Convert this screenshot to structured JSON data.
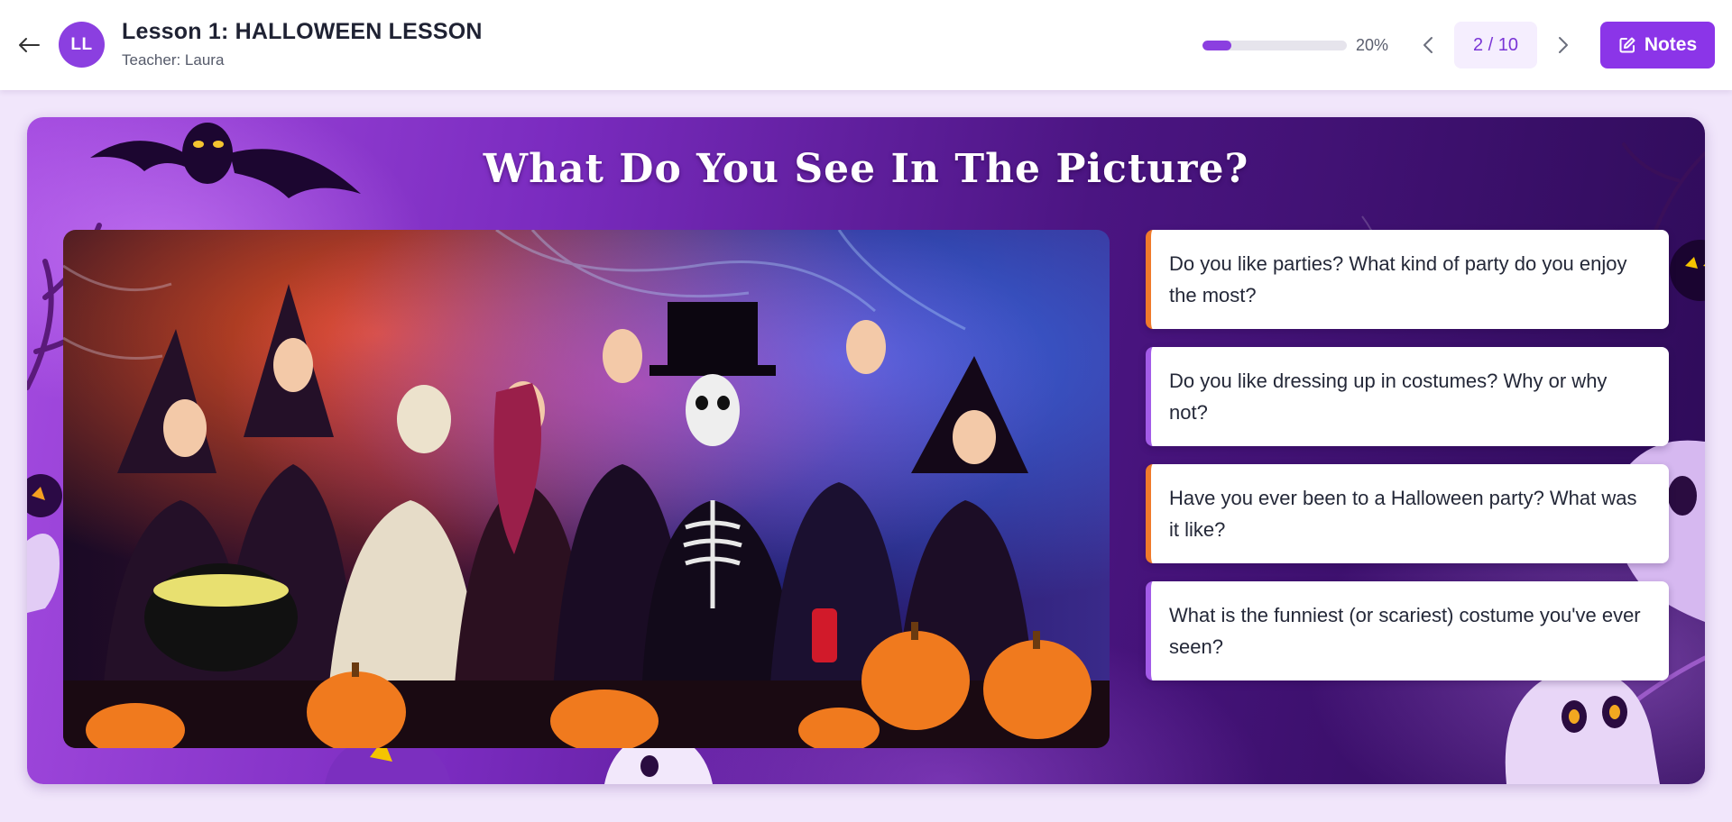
{
  "header": {
    "back_label": "Back",
    "avatar_initials": "LL",
    "lesson_title": "Lesson 1: HALLOWEEN LESSON",
    "teacher": "Teacher: Laura",
    "progress": {
      "fraction": 0.2,
      "label": "20%"
    },
    "page_indicator": "2 / 10",
    "notes_label": "Notes"
  },
  "slide": {
    "title": "What Do You See In The Picture?",
    "image_description_icon": "halloween-party-photo",
    "questions": [
      {
        "text": "Do you like parties? What kind of party do you enjoy the most?",
        "accent": "#f07a2b"
      },
      {
        "text": "Do you like dressing up in costumes? Why or why not?",
        "accent": "#a35be8"
      },
      {
        "text": "Have you ever been to a Halloween party? What was it like?",
        "accent": "#f07a2b"
      },
      {
        "text": "What is the funniest (or scariest) costume you've ever seen?",
        "accent": "#a35be8"
      }
    ]
  },
  "colors": {
    "accent_purple": "#8b35e8",
    "page_background": "#f1e6fb",
    "slide_gradient_start": "#a44be0",
    "slide_gradient_end": "#2d0b57"
  }
}
